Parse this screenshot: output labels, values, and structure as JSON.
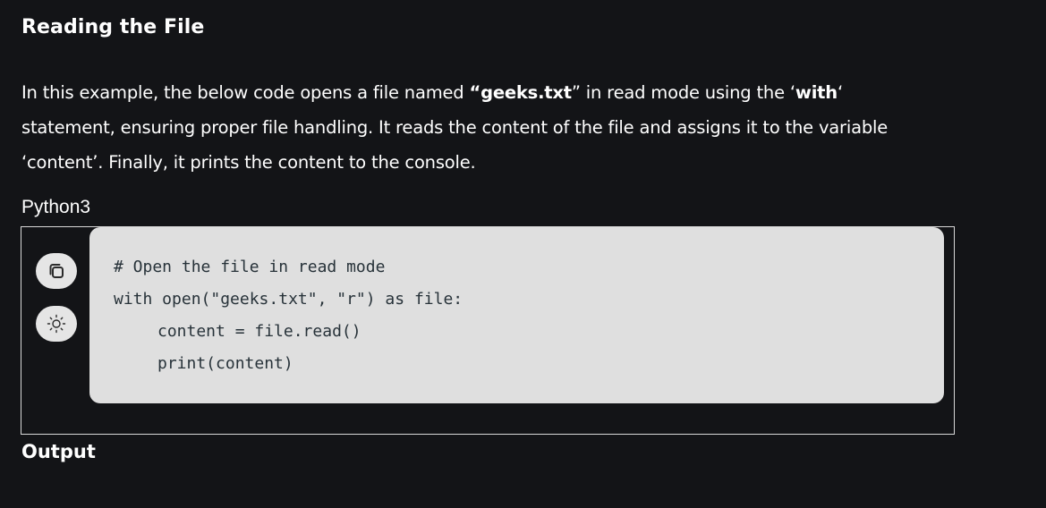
{
  "section": {
    "heading": "Reading the File",
    "paragraph": {
      "part1": "In this example, the below code opens a file named ",
      "filename": "“geeks.txt",
      "part2": "” in read mode using the ‘",
      "keyword": "with",
      "part3": "‘ statement, ensuring proper file handling. It reads the content of the file and assigns it to the variable ‘content’. Finally, it prints the content to the console."
    }
  },
  "code_block": {
    "language_label": "Python3",
    "copy_icon": "copy-icon",
    "theme_icon": "sun-icon",
    "lines": [
      "# Open the file in read mode",
      "with open(\"geeks.txt\", \"r\") as file:",
      "content = file.read()",
      "print(content)"
    ],
    "colors": {
      "code_background": "#dfdfdf",
      "code_text": "#273239",
      "page_background": "#131417"
    }
  },
  "output": {
    "heading": "Output"
  }
}
